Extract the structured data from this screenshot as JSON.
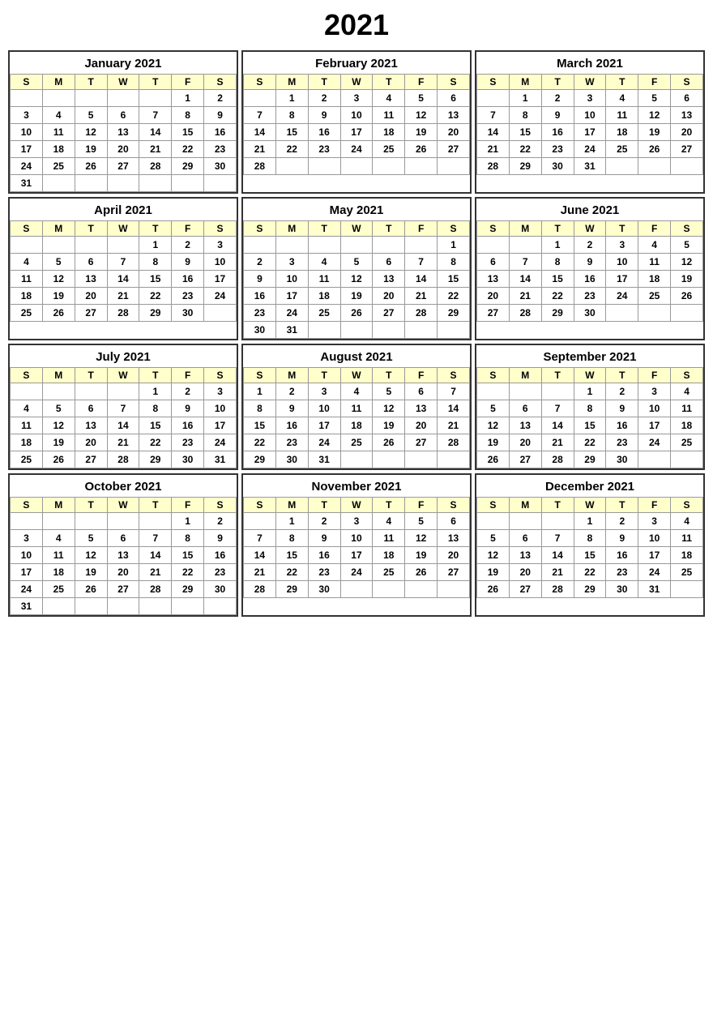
{
  "year": "2021",
  "months": [
    {
      "name": "January 2021",
      "days_of_week": [
        "S",
        "M",
        "T",
        "W",
        "T",
        "F",
        "S"
      ],
      "weeks": [
        [
          "",
          "",
          "",
          "",
          "",
          "1",
          "2"
        ],
        [
          "3",
          "4",
          "5",
          "6",
          "7",
          "8",
          "9"
        ],
        [
          "10",
          "11",
          "12",
          "13",
          "14",
          "15",
          "16"
        ],
        [
          "17",
          "18",
          "19",
          "20",
          "21",
          "22",
          "23"
        ],
        [
          "24",
          "25",
          "26",
          "27",
          "28",
          "29",
          "30"
        ],
        [
          "31",
          "",
          "",
          "",
          "",
          "",
          ""
        ]
      ]
    },
    {
      "name": "February 2021",
      "days_of_week": [
        "S",
        "M",
        "T",
        "W",
        "T",
        "F",
        "S"
      ],
      "weeks": [
        [
          "",
          "1",
          "2",
          "3",
          "4",
          "5",
          "6"
        ],
        [
          "7",
          "8",
          "9",
          "10",
          "11",
          "12",
          "13"
        ],
        [
          "14",
          "15",
          "16",
          "17",
          "18",
          "19",
          "20"
        ],
        [
          "21",
          "22",
          "23",
          "24",
          "25",
          "26",
          "27"
        ],
        [
          "28",
          "",
          "",
          "",
          "",
          "",
          ""
        ]
      ]
    },
    {
      "name": "March 2021",
      "days_of_week": [
        "S",
        "M",
        "T",
        "W",
        "T",
        "F",
        "S"
      ],
      "weeks": [
        [
          "",
          "1",
          "2",
          "3",
          "4",
          "5",
          "6"
        ],
        [
          "7",
          "8",
          "9",
          "10",
          "11",
          "12",
          "13"
        ],
        [
          "14",
          "15",
          "16",
          "17",
          "18",
          "19",
          "20"
        ],
        [
          "21",
          "22",
          "23",
          "24",
          "25",
          "26",
          "27"
        ],
        [
          "28",
          "29",
          "30",
          "31",
          "",
          "",
          ""
        ]
      ]
    },
    {
      "name": "April 2021",
      "days_of_week": [
        "S",
        "M",
        "T",
        "W",
        "T",
        "F",
        "S"
      ],
      "weeks": [
        [
          "",
          "",
          "",
          "",
          "1",
          "2",
          "3"
        ],
        [
          "4",
          "5",
          "6",
          "7",
          "8",
          "9",
          "10"
        ],
        [
          "11",
          "12",
          "13",
          "14",
          "15",
          "16",
          "17"
        ],
        [
          "18",
          "19",
          "20",
          "21",
          "22",
          "23",
          "24"
        ],
        [
          "25",
          "26",
          "27",
          "28",
          "29",
          "30",
          ""
        ]
      ]
    },
    {
      "name": "May 2021",
      "days_of_week": [
        "S",
        "M",
        "T",
        "W",
        "T",
        "F",
        "S"
      ],
      "weeks": [
        [
          "",
          "",
          "",
          "",
          "",
          "",
          "1"
        ],
        [
          "2",
          "3",
          "4",
          "5",
          "6",
          "7",
          "8"
        ],
        [
          "9",
          "10",
          "11",
          "12",
          "13",
          "14",
          "15"
        ],
        [
          "16",
          "17",
          "18",
          "19",
          "20",
          "21",
          "22"
        ],
        [
          "23",
          "24",
          "25",
          "26",
          "27",
          "28",
          "29"
        ],
        [
          "30",
          "31",
          "",
          "",
          "",
          "",
          ""
        ]
      ]
    },
    {
      "name": "June 2021",
      "days_of_week": [
        "S",
        "M",
        "T",
        "W",
        "T",
        "F",
        "S"
      ],
      "weeks": [
        [
          "",
          "",
          "1",
          "2",
          "3",
          "4",
          "5"
        ],
        [
          "6",
          "7",
          "8",
          "9",
          "10",
          "11",
          "12"
        ],
        [
          "13",
          "14",
          "15",
          "16",
          "17",
          "18",
          "19"
        ],
        [
          "20",
          "21",
          "22",
          "23",
          "24",
          "25",
          "26"
        ],
        [
          "27",
          "28",
          "29",
          "30",
          "",
          "",
          ""
        ]
      ]
    },
    {
      "name": "July 2021",
      "days_of_week": [
        "S",
        "M",
        "T",
        "W",
        "T",
        "F",
        "S"
      ],
      "weeks": [
        [
          "",
          "",
          "",
          "",
          "1",
          "2",
          "3"
        ],
        [
          "4",
          "5",
          "6",
          "7",
          "8",
          "9",
          "10"
        ],
        [
          "11",
          "12",
          "13",
          "14",
          "15",
          "16",
          "17"
        ],
        [
          "18",
          "19",
          "20",
          "21",
          "22",
          "23",
          "24"
        ],
        [
          "25",
          "26",
          "27",
          "28",
          "29",
          "30",
          "31"
        ]
      ]
    },
    {
      "name": "August 2021",
      "days_of_week": [
        "S",
        "M",
        "T",
        "W",
        "T",
        "F",
        "S"
      ],
      "weeks": [
        [
          "1",
          "2",
          "3",
          "4",
          "5",
          "6",
          "7"
        ],
        [
          "8",
          "9",
          "10",
          "11",
          "12",
          "13",
          "14"
        ],
        [
          "15",
          "16",
          "17",
          "18",
          "19",
          "20",
          "21"
        ],
        [
          "22",
          "23",
          "24",
          "25",
          "26",
          "27",
          "28"
        ],
        [
          "29",
          "30",
          "31",
          "",
          "",
          "",
          ""
        ]
      ]
    },
    {
      "name": "September 2021",
      "days_of_week": [
        "S",
        "M",
        "T",
        "W",
        "T",
        "F",
        "S"
      ],
      "weeks": [
        [
          "",
          "",
          "",
          "1",
          "2",
          "3",
          "4"
        ],
        [
          "5",
          "6",
          "7",
          "8",
          "9",
          "10",
          "11"
        ],
        [
          "12",
          "13",
          "14",
          "15",
          "16",
          "17",
          "18"
        ],
        [
          "19",
          "20",
          "21",
          "22",
          "23",
          "24",
          "25"
        ],
        [
          "26",
          "27",
          "28",
          "29",
          "30",
          "",
          ""
        ]
      ]
    },
    {
      "name": "October 2021",
      "days_of_week": [
        "S",
        "M",
        "T",
        "W",
        "T",
        "F",
        "S"
      ],
      "weeks": [
        [
          "",
          "",
          "",
          "",
          "",
          "1",
          "2"
        ],
        [
          "3",
          "4",
          "5",
          "6",
          "7",
          "8",
          "9"
        ],
        [
          "10",
          "11",
          "12",
          "13",
          "14",
          "15",
          "16"
        ],
        [
          "17",
          "18",
          "19",
          "20",
          "21",
          "22",
          "23"
        ],
        [
          "24",
          "25",
          "26",
          "27",
          "28",
          "29",
          "30"
        ],
        [
          "31",
          "",
          "",
          "",
          "",
          "",
          ""
        ]
      ]
    },
    {
      "name": "November 2021",
      "days_of_week": [
        "S",
        "M",
        "T",
        "W",
        "T",
        "F",
        "S"
      ],
      "weeks": [
        [
          "",
          "1",
          "2",
          "3",
          "4",
          "5",
          "6"
        ],
        [
          "7",
          "8",
          "9",
          "10",
          "11",
          "12",
          "13"
        ],
        [
          "14",
          "15",
          "16",
          "17",
          "18",
          "19",
          "20"
        ],
        [
          "21",
          "22",
          "23",
          "24",
          "25",
          "26",
          "27"
        ],
        [
          "28",
          "29",
          "30",
          "",
          "",
          "",
          ""
        ]
      ]
    },
    {
      "name": "December 2021",
      "days_of_week": [
        "S",
        "M",
        "T",
        "W",
        "T",
        "F",
        "S"
      ],
      "weeks": [
        [
          "",
          "",
          "",
          "1",
          "2",
          "3",
          "4"
        ],
        [
          "5",
          "6",
          "7",
          "8",
          "9",
          "10",
          "11"
        ],
        [
          "12",
          "13",
          "14",
          "15",
          "16",
          "17",
          "18"
        ],
        [
          "19",
          "20",
          "21",
          "22",
          "23",
          "24",
          "25"
        ],
        [
          "26",
          "27",
          "28",
          "29",
          "30",
          "31",
          ""
        ]
      ]
    }
  ]
}
